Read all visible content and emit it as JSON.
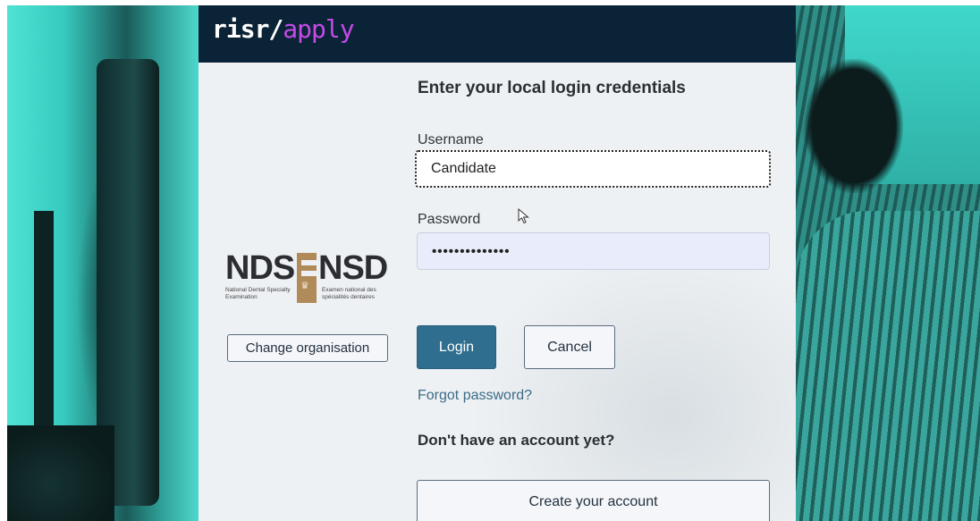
{
  "brand": {
    "name": "risr/",
    "product": "apply"
  },
  "login": {
    "heading": "Enter your local login credentials",
    "username_label": "Username",
    "username_value": "Candidate",
    "password_label": "Password",
    "password_masked": "••••••••••••••",
    "login_button": "Login",
    "cancel_button": "Cancel",
    "forgot_password": "Forgot password?",
    "no_account_prompt": "Don't have an account yet?",
    "create_account_button": "Create your account"
  },
  "organisation": {
    "logo_left": "NDS",
    "logo_right": "NSD",
    "subtitle_en": "National Dental Specialty Examination",
    "subtitle_fr": "Examen national des spécialités dentaires",
    "change_button": "Change organisation"
  },
  "colors": {
    "brand_bar": "#0b2337",
    "brand_accent": "#c64ae6",
    "primary_button": "#2f6e8e",
    "logo_gold": "#b08a58",
    "background_teal": "#3bcfc3"
  },
  "icons": {
    "cursor": "mouse-pointer-icon",
    "logo_mark": "crown-icon"
  }
}
